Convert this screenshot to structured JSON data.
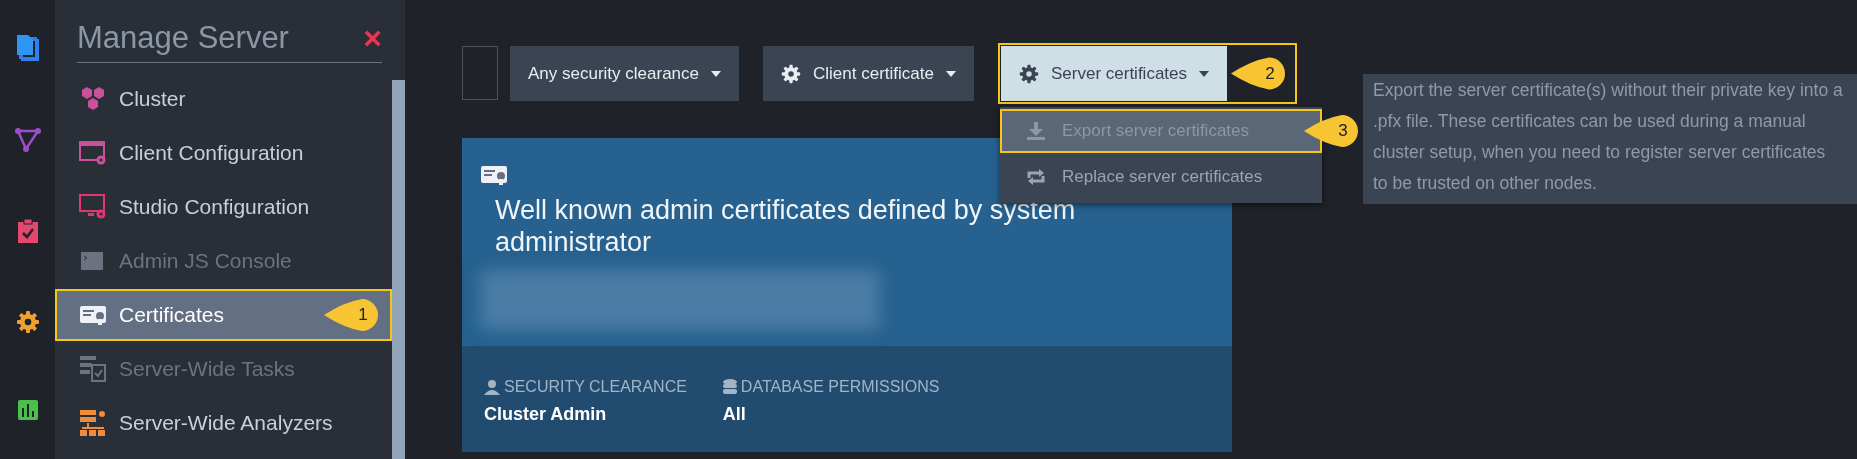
{
  "sidebar": {
    "title": "Manage Server",
    "close": "×",
    "items": [
      {
        "label": "Cluster",
        "disabled": false,
        "selected": false
      },
      {
        "label": "Client Configuration",
        "disabled": false,
        "selected": false
      },
      {
        "label": "Studio Configuration",
        "disabled": false,
        "selected": false
      },
      {
        "label": "Admin JS Console",
        "disabled": true,
        "selected": false
      },
      {
        "label": "Certificates",
        "disabled": false,
        "selected": true,
        "callout": "1"
      },
      {
        "label": "Server-Wide Tasks",
        "disabled": true,
        "selected": false
      },
      {
        "label": "Server-Wide Analyzers",
        "disabled": false,
        "selected": false
      }
    ]
  },
  "toolbar": {
    "buttons": [
      {
        "label": "Any security clearance",
        "kind": "dropdown",
        "expanded": false
      },
      {
        "label": "Client certificate",
        "kind": "gear-dropdown",
        "expanded": false
      },
      {
        "label": "Server certificates",
        "kind": "gear-dropdown",
        "expanded": true,
        "callout": "2",
        "menu": [
          {
            "label": "Export server certificates",
            "highlighted": true,
            "callout": "3"
          },
          {
            "label": "Replace server certificates",
            "highlighted": false
          }
        ]
      }
    ]
  },
  "tooltip": "Export the server certificate(s) without their private key into a .pfx file. These certificates can be used during a manual cluster setup, when you need to register server certificates to be trusted on other nodes.",
  "card": {
    "title": "Well known admin certificates defined by system administrator",
    "fields": [
      {
        "label": "SECURITY CLEARANCE",
        "value": "Cluster Admin"
      },
      {
        "label": "DATABASE PERMISSIONS",
        "value": "All"
      }
    ]
  }
}
